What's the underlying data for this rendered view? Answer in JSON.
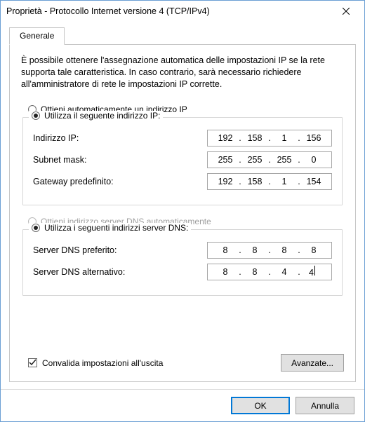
{
  "window": {
    "title": "Proprietà - Protocollo Internet versione 4 (TCP/IPv4)"
  },
  "tab": {
    "general": "Generale"
  },
  "description": "È possibile ottenere l'assegnazione automatica delle impostazioni IP se la rete supporta tale caratteristica. In caso contrario, sarà necessario richiedere all'amministratore di rete le impostazioni IP corrette.",
  "ip": {
    "radio_auto": "Ottieni automaticamente un indirizzo IP",
    "radio_manual": "Utilizza il seguente indirizzo IP:",
    "label_address": "Indirizzo IP:",
    "label_subnet": "Subnet mask:",
    "label_gateway": "Gateway predefinito:",
    "address": {
      "o1": "192",
      "o2": "158",
      "o3": "1",
      "o4": "156"
    },
    "subnet": {
      "o1": "255",
      "o2": "255",
      "o3": "255",
      "o4": "0"
    },
    "gateway": {
      "o1": "192",
      "o2": "158",
      "o3": "1",
      "o4": "154"
    }
  },
  "dns": {
    "radio_auto": "Ottieni indirizzo server DNS automaticamente",
    "radio_manual": "Utilizza i seguenti indirizzi server DNS:",
    "label_preferred": "Server DNS preferito:",
    "label_alternate": "Server DNS alternativo:",
    "preferred": {
      "o1": "8",
      "o2": "8",
      "o3": "8",
      "o4": "8"
    },
    "alternate": {
      "o1": "8",
      "o2": "8",
      "o3": "4",
      "o4": "4"
    }
  },
  "validate_label": "Convalida impostazioni all'uscita",
  "advanced_label": "Avanzate...",
  "buttons": {
    "ok": "OK",
    "cancel": "Annulla"
  }
}
